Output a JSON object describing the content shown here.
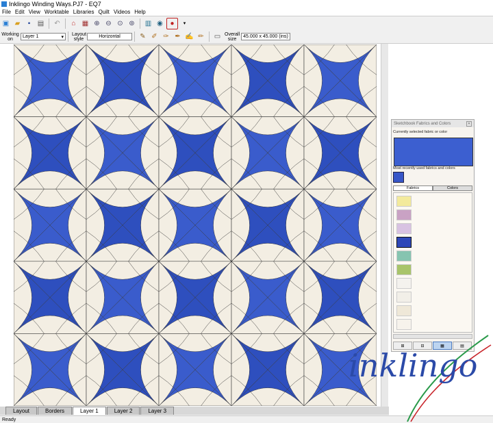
{
  "app": {
    "title": "Inklingo Winding Ways.PJ7 - EQ7"
  },
  "menu": [
    "File",
    "Edit",
    "View",
    "Worktable",
    "Libraries",
    "Quilt",
    "Videos",
    "Help"
  ],
  "toolbar2": {
    "working_on_label": "Working on",
    "layer_value": "Layer 1",
    "layout_style_label": "Layout style",
    "layout_style_value": "Horizontal",
    "overall_size_label": "Overall size",
    "overall_size_value": "45.000 x 45.000 (ins)"
  },
  "quilt": {
    "rows": 5,
    "cols": 5,
    "blue": "#3a5ccc",
    "dark_blue": "#2e4fbe",
    "cream": "#f3eee3",
    "seam": "#3a3a3a"
  },
  "panel": {
    "title": "Sketchbook Fabrics and Colors",
    "current_label": "Currently selected fabric or color",
    "recent_label": "Most recently used fabrics and colors",
    "tabs": [
      "Fabrics",
      "Colors"
    ],
    "swatches": [
      "#f3ea9c",
      "#c9a2c4",
      "#d8c2e2",
      "#2e48b8",
      "#86c4b0",
      "#a8c46a",
      "#f4f2ee",
      "#f2efe8",
      "#efe8d8",
      "#f7f3ec"
    ]
  },
  "tabs": [
    "Layout",
    "Borders",
    "Layer 1",
    "Layer 2",
    "Layer 3"
  ],
  "status": {
    "text": "Ready"
  },
  "logo": {
    "text": "inklingo"
  }
}
